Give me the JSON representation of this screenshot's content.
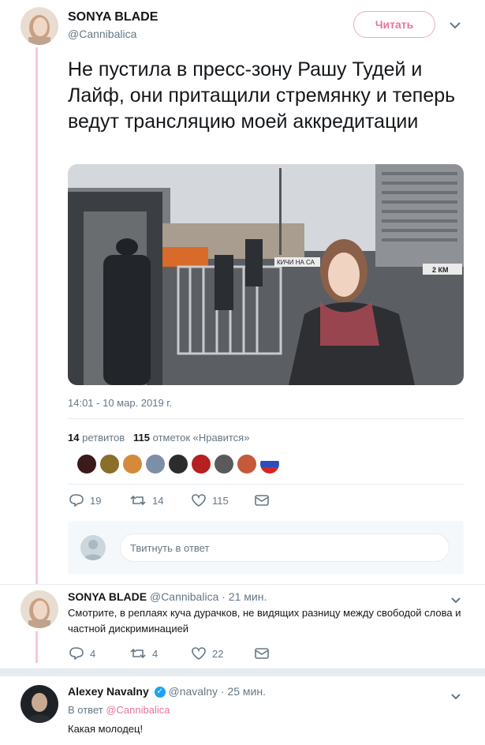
{
  "main_tweet": {
    "author_name": "SONYA BLADE",
    "author_handle": "@Cannibalica",
    "follow_label": "Читать",
    "text": "Не пустила в пресс-зону Рашу Тудей и Лайф, они притащили стремянку и теперь ведут трансляцию моей аккредитации",
    "timestamp": "14:01 - 10 мар. 2019 г.",
    "retweets_count": "14",
    "retweets_label": "ретвитов",
    "likes_count": "115",
    "likes_label": "отметок «Нравится»",
    "actions": {
      "replies": "19",
      "retweets": "14",
      "likes": "115"
    },
    "photo_signs": {
      "banner": "КИЧИ НА СА",
      "distance": "2 КМ"
    }
  },
  "reply_box": {
    "placeholder": "Твитнуть в ответ"
  },
  "reply1": {
    "author_name": "SONYA BLADE",
    "author_handle": "@Cannibalica",
    "time": "· 21 мин.",
    "text": "Смотрите, в реплаях куча дурачков, не видящих разницу между свободой слова и частной дискриминацией",
    "actions": {
      "replies": "4",
      "retweets": "4",
      "likes": "22"
    }
  },
  "reply2": {
    "author_name": "Alexey Navalny",
    "author_handle": "@navalny",
    "time": "· 25 мин.",
    "reply_to_prefix": "В ответ",
    "reply_to_handle": "@Cannibalica",
    "text": "Какая молодец!"
  },
  "colors": {
    "accent": "#e6739f",
    "thread": "#f5c6dd",
    "muted": "#657786",
    "verified": "#1da1f2"
  }
}
